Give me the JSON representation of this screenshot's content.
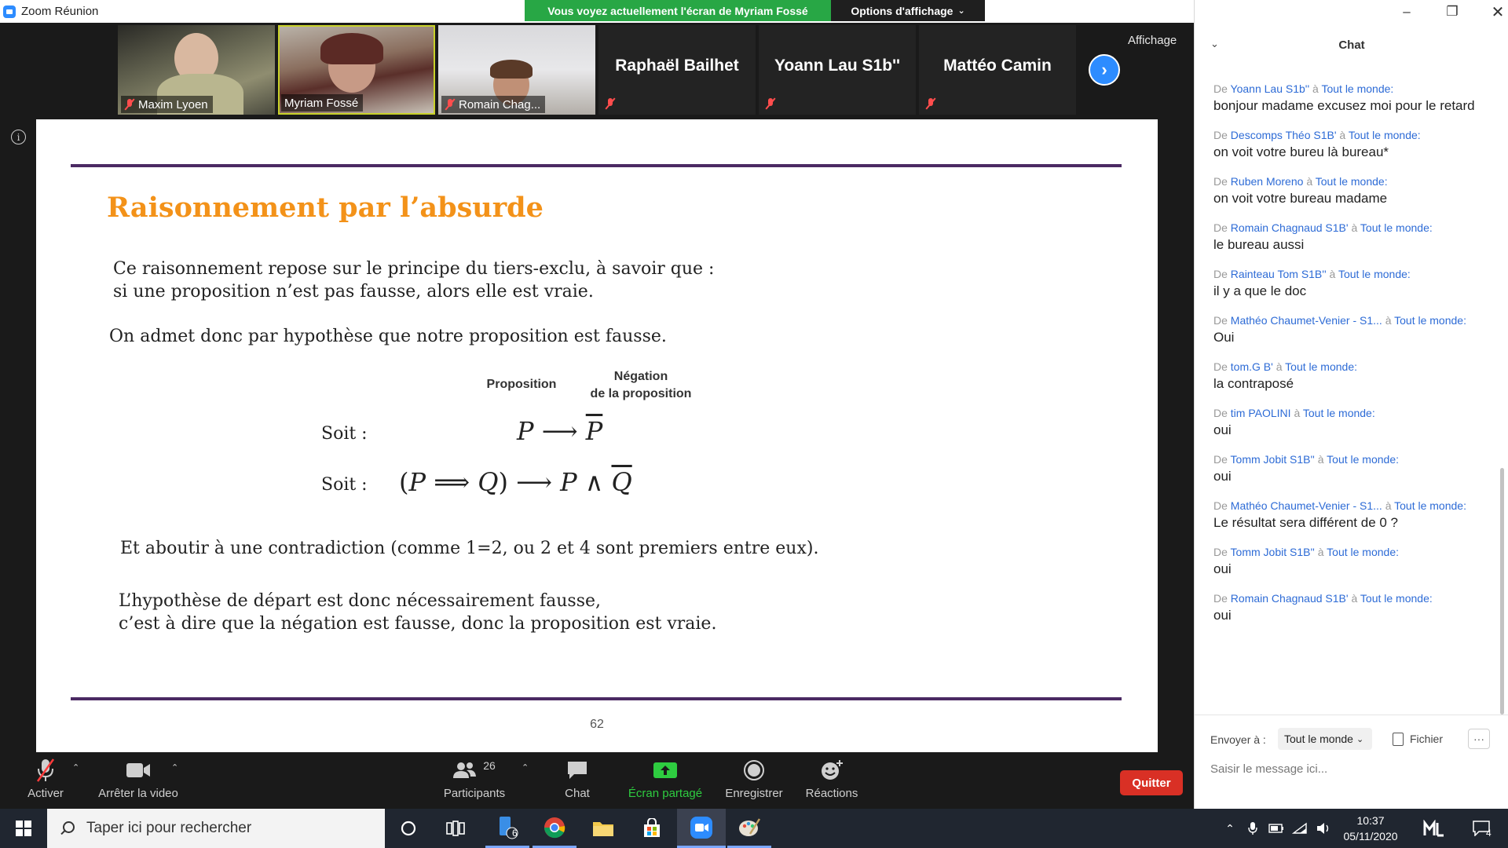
{
  "window": {
    "title": "Zoom Réunion",
    "share_banner": "Vous voyez actuellement l'écran de Myriam Fossé",
    "view_options": "Options d'affichage",
    "view_label": "Affichage"
  },
  "participants_strip": [
    {
      "name": "Maxim Lyoen",
      "has_video": true,
      "muted": true
    },
    {
      "name": "Myriam Fossé",
      "has_video": true,
      "muted": false,
      "active_speaker": true
    },
    {
      "name": "Romain Chag...",
      "has_video": true,
      "muted": true
    },
    {
      "name": "Raphaël Bailhet",
      "has_video": false,
      "muted": true
    },
    {
      "name": "Yoann Lau S1b''",
      "has_video": false,
      "muted": true
    },
    {
      "name": "Mattéo Camin",
      "has_video": false,
      "muted": true
    }
  ],
  "slide": {
    "title": "Raisonnement par l’absurde",
    "para1_line1": "Ce raisonnement repose sur le principe du tiers-exclu, à savoir que :",
    "para1_line2": "si une proposition n’est pas fausse, alors elle est vraie.",
    "para2": "On admet donc par hypothèse que notre proposition  est fausse.",
    "header_proposition": "Proposition",
    "header_negation_line1": "Négation",
    "header_negation_line2": "de  la proposition",
    "soit_label": "Soit :",
    "para3": "Et aboutir à une contradiction (comme 1=2, ou 2 et 4 sont premiers entre eux).",
    "para4_line1": "L’hypothèse de départ est donc nécessairement fausse,",
    "para4_line2": "c’est à dire que la négation est fausse, donc la proposition est vraie.",
    "page_number": "62"
  },
  "toolbar": {
    "unmute": "Activer",
    "stop_video": "Arrêter la video",
    "participants": "Participants",
    "participants_count": "26",
    "chat": "Chat",
    "share_screen": "Écran partagé",
    "record": "Enregistrer",
    "reactions": "Réactions",
    "leave": "Quitter"
  },
  "chat": {
    "title": "Chat",
    "from_word": "De",
    "to_word": "à",
    "everyone": "Tout le monde:",
    "messages": [
      {
        "sender": "Yoann Lau S1b''",
        "text": "bonjour madame excusez moi pour le retard"
      },
      {
        "sender": "Descomps Théo S1B'",
        "text": "on voit votre bureu là bureau*"
      },
      {
        "sender": "Ruben Moreno",
        "text": "on voit votre bureau madame"
      },
      {
        "sender": "Romain Chagnaud S1B'",
        "text": "le bureau aussi"
      },
      {
        "sender": "Rainteau Tom S1B''",
        "text": "il y a que le doc"
      },
      {
        "sender": "Mathéo Chaumet-Venier - S1...",
        "text": "Oui"
      },
      {
        "sender": "tom.G B'",
        "text": "la contraposé"
      },
      {
        "sender": "tim PAOLINI",
        "text": "oui"
      },
      {
        "sender": "Tomm Jobit S1B''",
        "text": "oui"
      },
      {
        "sender": "Mathéo Chaumet-Venier - S1...",
        "text": "Le résultat sera différent de 0 ?"
      },
      {
        "sender": "Tomm Jobit S1B''",
        "text": "oui"
      },
      {
        "sender": "Romain Chagnaud S1B'",
        "text": "oui"
      }
    ],
    "send_to_label": "Envoyer à :",
    "send_to_value": "Tout le monde",
    "file_label": "Fichier",
    "more_label": "···",
    "input_placeholder": "Saisir le message ici..."
  },
  "taskbar": {
    "search_placeholder": "Taper ici pour rechercher",
    "badge_count": "6",
    "notification_count": "4",
    "time": "10:37",
    "date": "05/11/2020"
  }
}
